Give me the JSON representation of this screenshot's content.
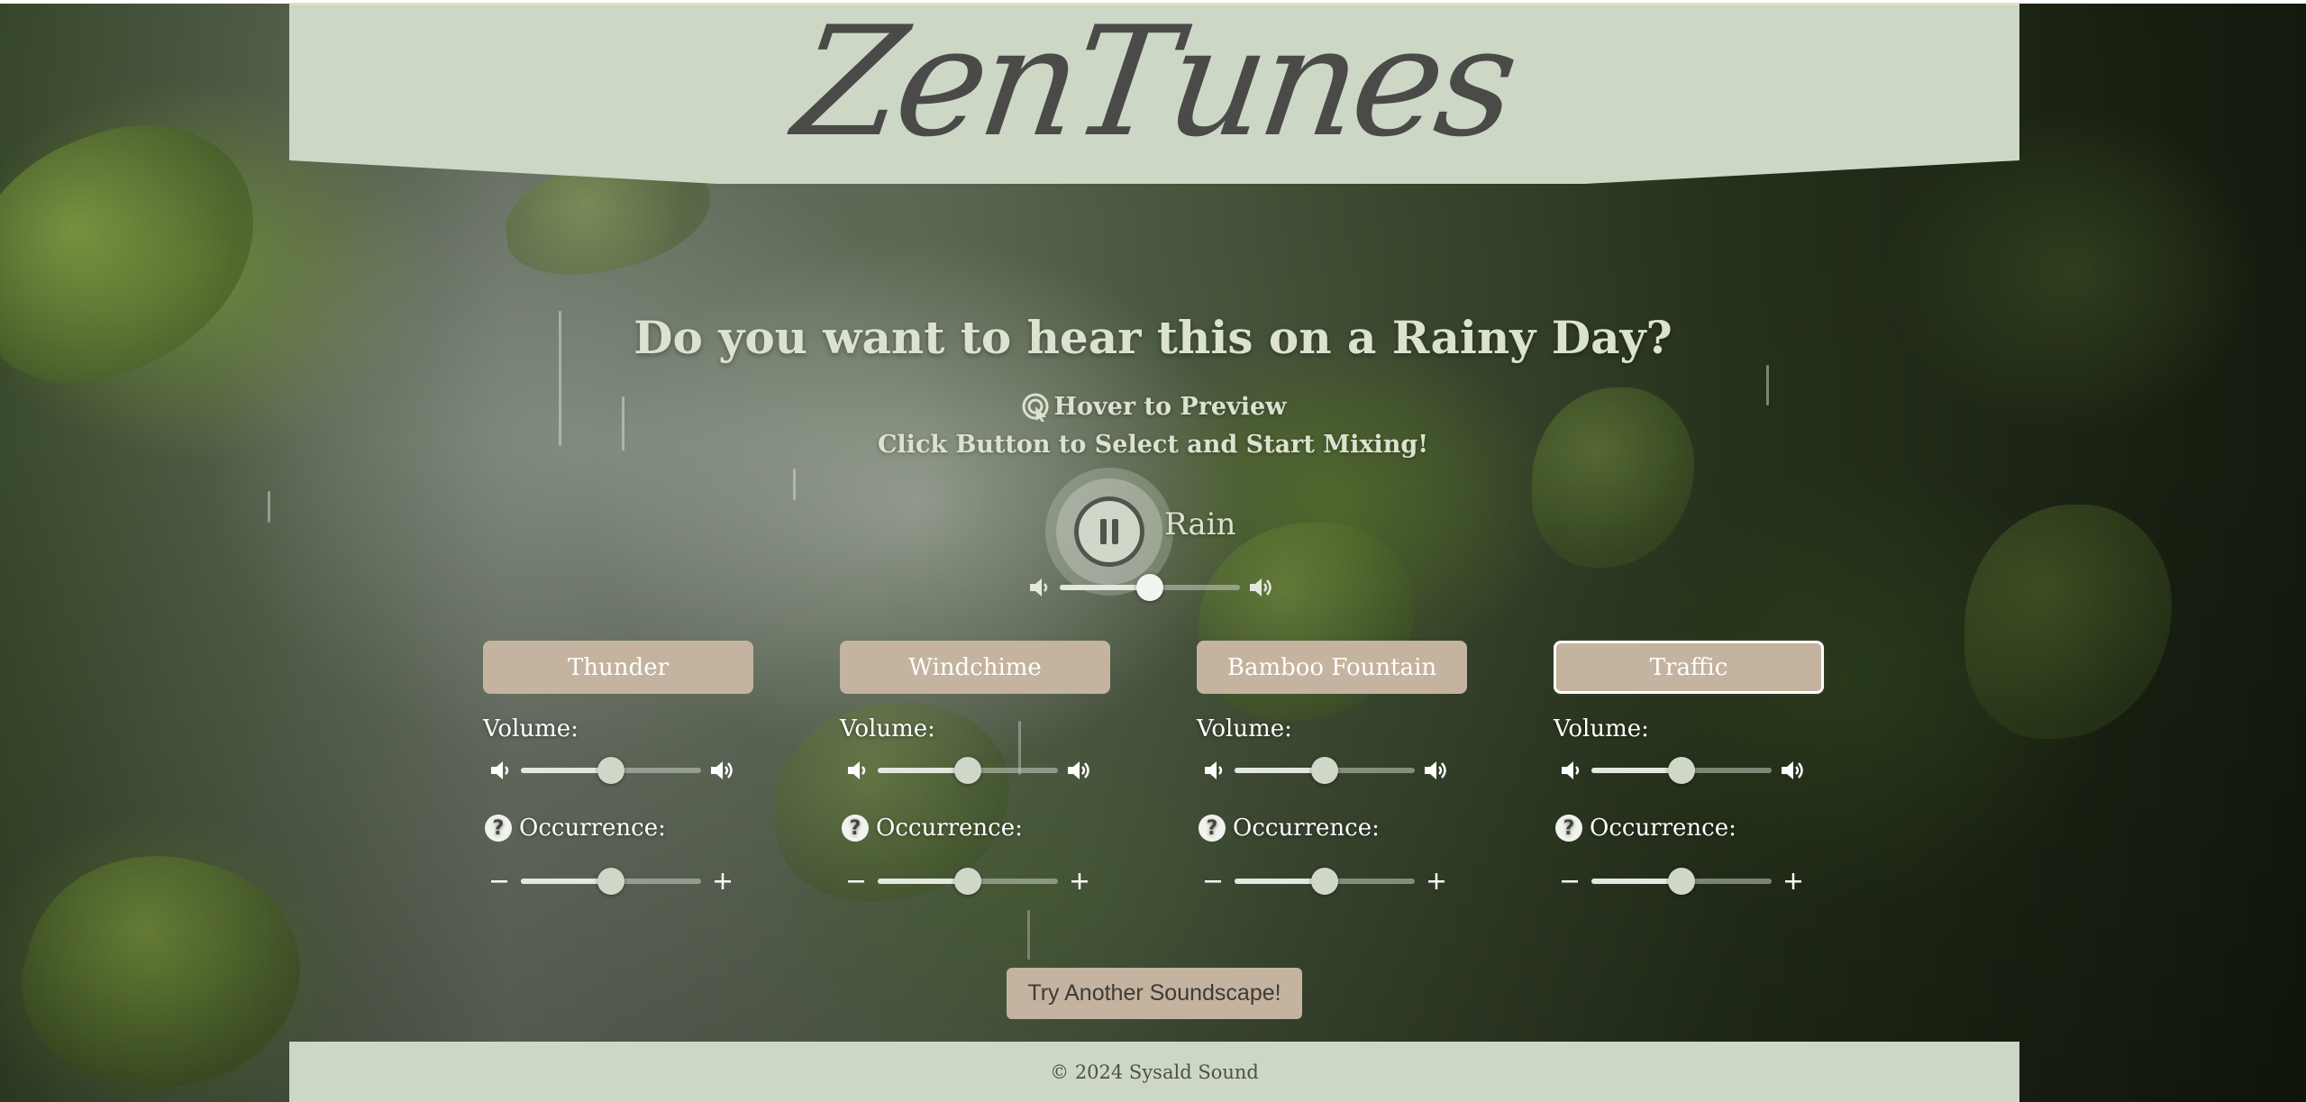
{
  "app": {
    "logo_text": "ZenTunes"
  },
  "intro": {
    "headline": "Do you want to hear this on a Rainy Day?",
    "hover_hint": "Hover to Preview",
    "hover_icon": "tap-icon",
    "click_hint": "Click Button to Select and Start Mixing!"
  },
  "main_sound": {
    "label": "Rain",
    "state": "playing",
    "play_icon": "pause-icon",
    "volume": 0.5
  },
  "sounds": [
    {
      "label": "Thunder",
      "selected": false,
      "volume_label": "Volume:",
      "occurrence_label": "Occurrence:",
      "volume": 0.5,
      "occurrence": 0.5
    },
    {
      "label": "Windchime",
      "selected": false,
      "volume_label": "Volume:",
      "occurrence_label": "Occurrence:",
      "volume": 0.5,
      "occurrence": 0.5
    },
    {
      "label": "Bamboo Fountain",
      "selected": false,
      "volume_label": "Volume:",
      "occurrence_label": "Occurrence:",
      "volume": 0.5,
      "occurrence": 0.5
    },
    {
      "label": "Traffic",
      "selected": true,
      "volume_label": "Volume:",
      "occurrence_label": "Occurrence:",
      "volume": 0.5,
      "occurrence": 0.5
    }
  ],
  "actions": {
    "try_another": "Try Another Soundscape!"
  },
  "footer": {
    "copyright": "© 2024 Sysald Sound"
  },
  "colors": {
    "header_bg": "#cdd7c6",
    "button_bg": "#c4b39e",
    "text_light": "#dbe2cf",
    "logo_text": "#4a4a48"
  }
}
